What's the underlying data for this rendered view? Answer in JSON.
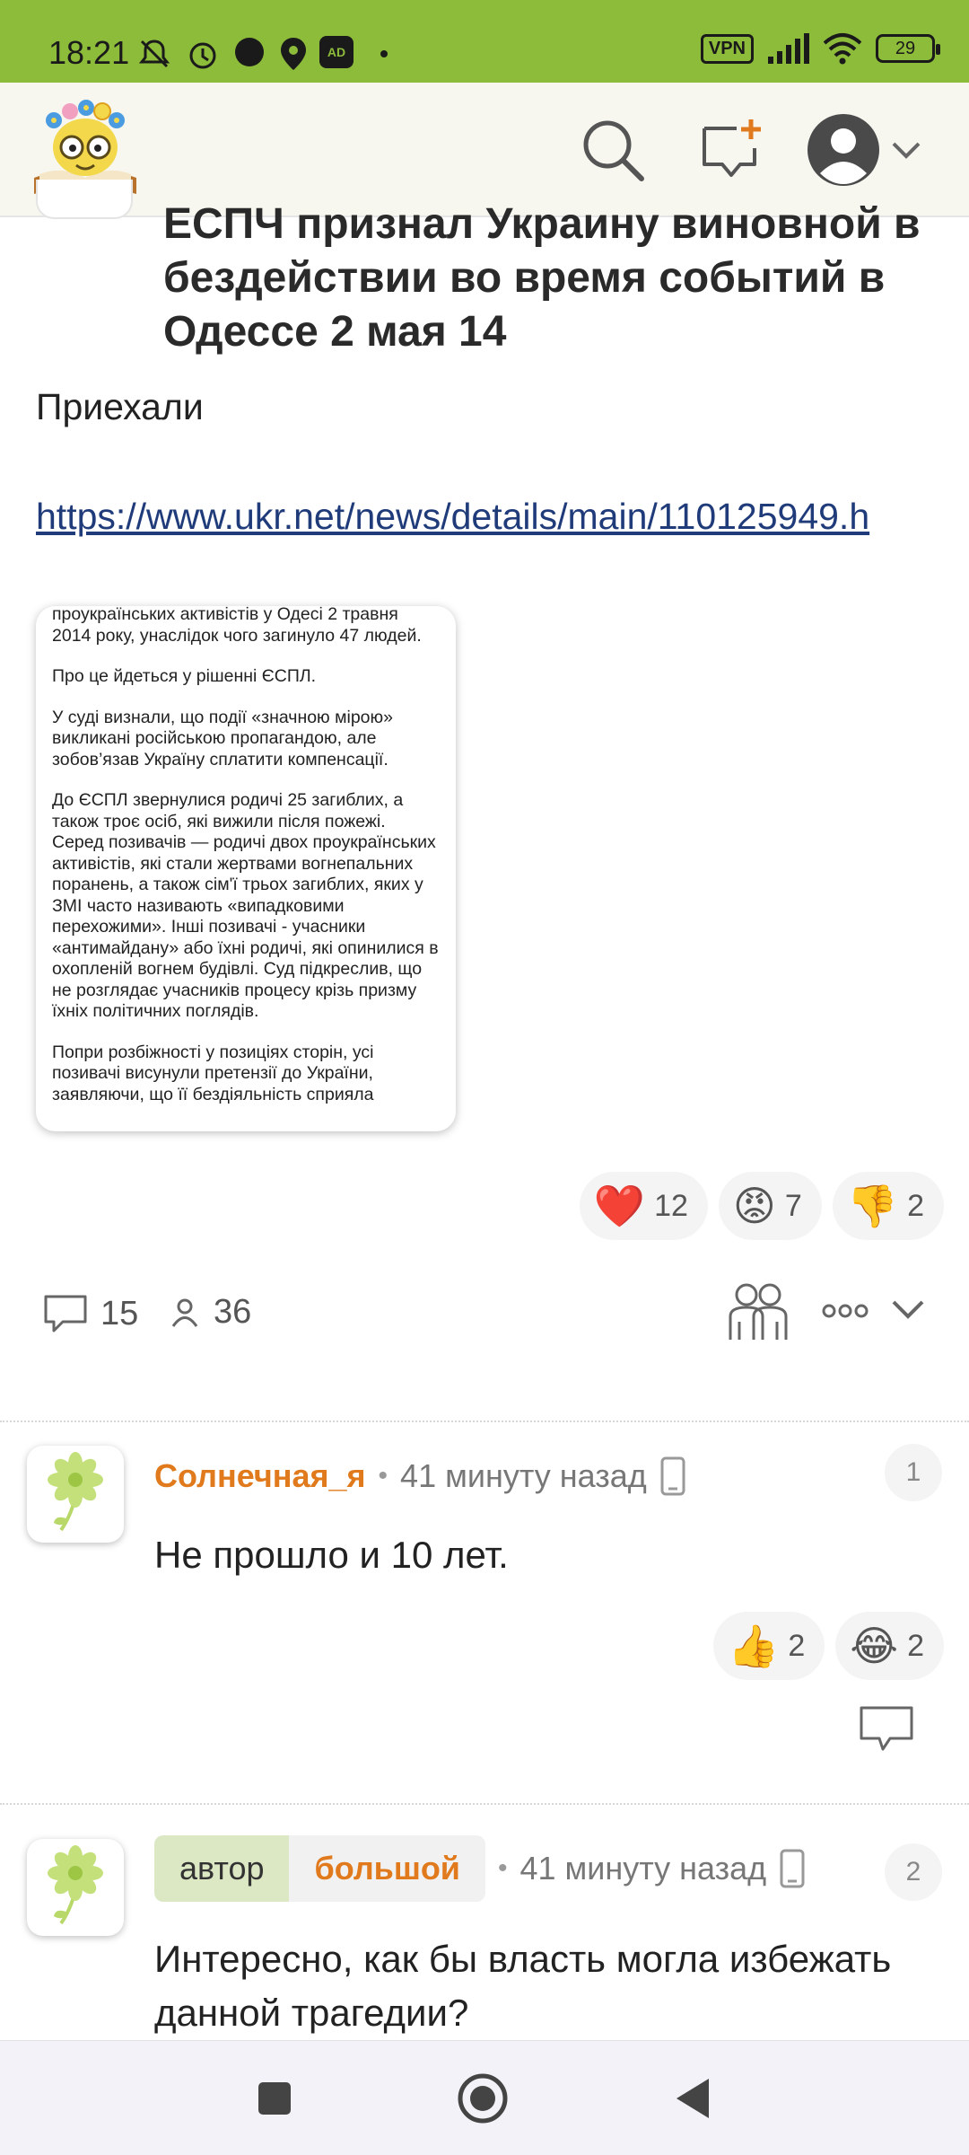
{
  "status_bar": {
    "time": "18:21",
    "vpn": "VPN",
    "battery": "29",
    "ad_badge": "AD"
  },
  "post": {
    "title": "ЕСПЧ признал Украину виновной в бездействии во время событий в Одессе 2 мая 14",
    "body": "Приехали",
    "link": "https://www.ukr.net/news/details/main/110125949.h",
    "screenshot_text": [
      "проукраїнських активістів у Одесі 2 травня 2014 року, унаслідок чого загинуло 47 людей.",
      "Про це йдеться у рішенні ЄСПЛ.",
      "У суді визнали, що події «значною мірою» викликані російською пропагандою, але зобов’язав Україну сплатити компенсації.",
      "До ЄСПЛ звернулися родичі 25 загиблих, а також троє осіб, які вижили після пожежі. Серед позивачів — родичі двох проукраїнських активістів, які стали жертвами вогнепальних поранень, а також сім'ї трьох загиблих, яких у ЗМІ часто називають «випадковими перехожими». Інші позивачі - учасники «антимайдану» або їхні родичі, які опинилися в охопленій вогнем будівлі. Суд підкреслив, що не розглядає учасників процесу крізь призму їхніх політичних поглядів.",
      "Попри розбіжності у позиціях сторін, усі позивачі висунули претензії до України, заявляючи, що її бездіяльність сприяла"
    ],
    "reactions": [
      {
        "emoji": "❤️",
        "count": "12"
      },
      {
        "emoji": "😡",
        "count": "7"
      },
      {
        "emoji": "👎",
        "count": "2"
      }
    ],
    "comments_count": "15",
    "viewers_count": "36"
  },
  "comments": [
    {
      "author": "Солнечная_я",
      "time": "41 минуту назад",
      "number": "1",
      "text": "Не прошло и 10 лет.",
      "reactions": [
        {
          "emoji": "👍",
          "count": "2"
        },
        {
          "emoji": "😂",
          "count": "2"
        }
      ]
    },
    {
      "author_tag": "автор",
      "author": "большой",
      "time": "41 минуту назад",
      "number": "2",
      "text": "Интересно, как бы власть могла избежать данной трагедии?"
    }
  ],
  "colors": {
    "status_bar": "#8dbb3a",
    "accent_orange": "#e07a1c",
    "link": "#1f3b7a"
  }
}
